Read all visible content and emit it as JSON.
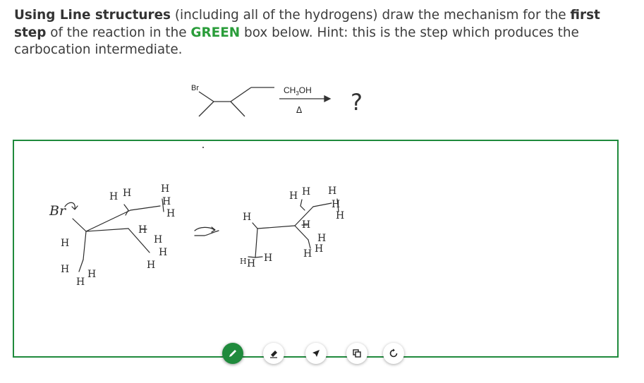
{
  "question": {
    "p1": "Using Line structures",
    "p2": " (including all of the hydrogens) draw the mechanism for the ",
    "p3": "first step",
    "p4": " of the reaction in the ",
    "p5": "GREEN",
    "p6": " box below. Hint: this is the step which produces the carbocation intermediate."
  },
  "reaction": {
    "bromine": "Br",
    "reagent_main": "CH",
    "reagent_sub": "3",
    "reagent_tail": "OH",
    "condition": "Δ",
    "product": "?"
  },
  "drawing": {
    "br_label": "Br",
    "h": "H"
  },
  "toolbar": {
    "tools": [
      "pen-tool",
      "eraser-tool",
      "pointer-tool",
      "copy-tool",
      "undo-tool"
    ],
    "active": "pen-tool"
  },
  "colors": {
    "box_border": "#1f8a3c",
    "active_tool": "#1f8a3c"
  }
}
